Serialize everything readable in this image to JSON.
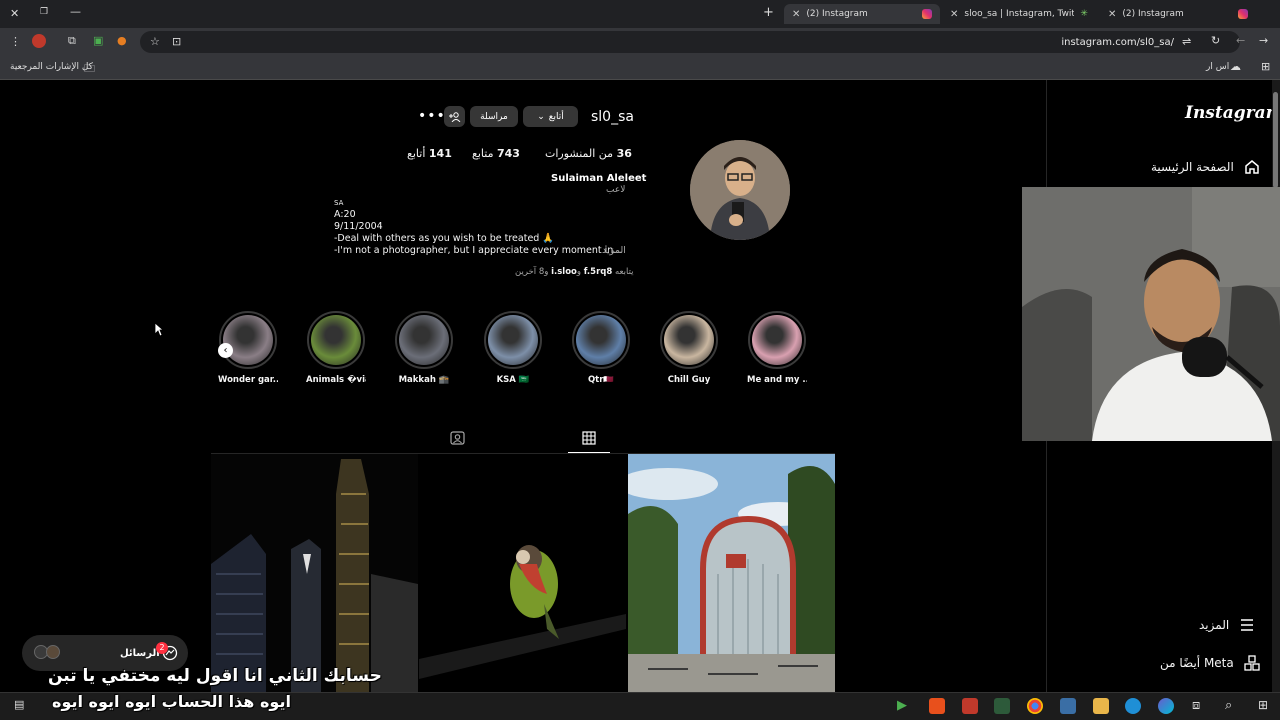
{
  "browser": {
    "tabs": [
      {
        "title": "(2) Instagram",
        "active": true
      },
      {
        "title": "sloo_sa | Instagram, Twitch | Lin",
        "active": false
      },
      {
        "title": "(2) Instagram",
        "active": false
      }
    ],
    "url": "instagram.com/sl0_sa/",
    "bookmarks_all": "كل الإشارات المرجعية",
    "profile_bookmark": "اس ار"
  },
  "sidebar": {
    "logo": "Instagram",
    "home": "الصفحة الرئيسية",
    "more": "المزيد",
    "meta": "أيضًا من Meta"
  },
  "profile": {
    "username": "sl0_sa",
    "follow_button": "أتابع",
    "message_button": "مراسلة",
    "posts_count": "36",
    "posts_label": "من المنشورات",
    "followers_count": "743",
    "followers_label": "متابع",
    "following_count": "141",
    "following_label": "أتابع",
    "full_name": "Sulaiman Aleleet",
    "category": "لاعب",
    "bio_lines": [
      "SA",
      "A:20",
      "9/11/2004",
      "-Deal with others as you wish to be treated 🙏",
      "-I'm not a photographer, but I appreciate every moment in..."
    ],
    "bio_more": "المزيد",
    "followed_by_prefix": "يتابعه",
    "followed_by_user1": "f.5rq8",
    "followed_by_and": "و",
    "followed_by_user2": "i.sloo",
    "followed_by_suffix": "و8 آخرين"
  },
  "highlights": [
    {
      "label": "Wonder gar...",
      "color": "#8a7e86"
    },
    {
      "label": "Animals �via",
      "color": "#6a8c3a"
    },
    {
      "label": "Makkah 🕋",
      "color": "#6b6e78"
    },
    {
      "label": "KSA 🇸🇦",
      "color": "#7d8fa8"
    },
    {
      "label": "Qtr🇶🇦",
      "color": "#5f7fa8"
    },
    {
      "label": "Chill Guy",
      "color": "#c9b6a0"
    },
    {
      "label": "Me and my ...",
      "color": "#d9a0b0"
    }
  ],
  "messages": {
    "label": "الرسائل",
    "badge": "2"
  },
  "subtitles": {
    "line1": "حسابك الثاني انا اقول ليه مختفي يا تبن",
    "line2": "ايوه هذا الحساب ايوه ايوه ايوه"
  },
  "colors": {
    "background": "#000000",
    "button": "#363636",
    "badge": "#ff3040"
  }
}
